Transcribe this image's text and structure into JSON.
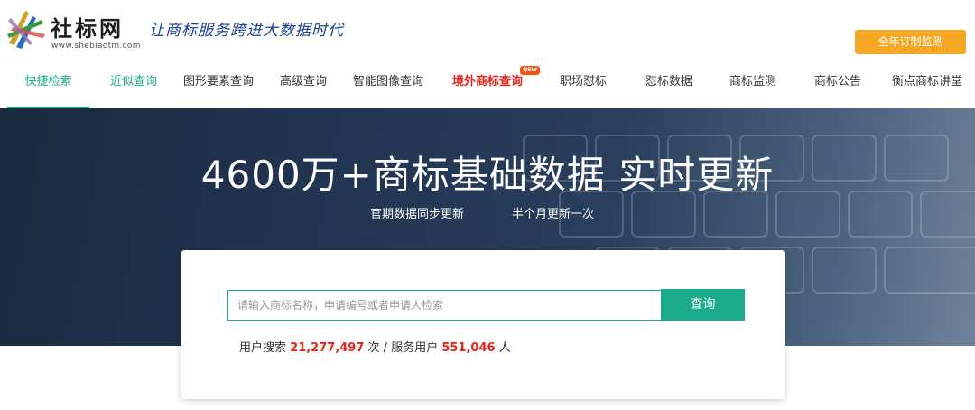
{
  "header": {
    "logo_name": "社标网",
    "logo_url": "www.shebiaotm.com",
    "slogan": "让商标服务跨进大数据时代",
    "order_button": "全年订制监测"
  },
  "nav": {
    "items": [
      {
        "label": "快捷检索"
      },
      {
        "label": "近似查询"
      },
      {
        "label": "图形要素查询"
      },
      {
        "label": "高级查询"
      },
      {
        "label": "智能图像查询"
      },
      {
        "label": "境外商标查询",
        "badge": "NEW"
      },
      {
        "label": "职场怼标"
      },
      {
        "label": "怼标数据"
      },
      {
        "label": "商标监测"
      },
      {
        "label": "商标公告"
      },
      {
        "label": "衡点商标讲堂"
      }
    ]
  },
  "hero": {
    "title": "4600万+商标基础数据 实时更新",
    "sub_left": "官期数据同步更新",
    "sub_right": "半个月更新一次"
  },
  "search": {
    "placeholder": "请输入商标名称，申请编号或者申请人检索",
    "button": "查询"
  },
  "stats": {
    "prefix": "用户搜索",
    "searches": "21,277,497",
    "mid": "次 / 服务用户",
    "users": "551,046",
    "suffix": "人"
  },
  "colors": {
    "accent": "#1aab8a",
    "highlight": "#e8231b",
    "order_button": "#f5a623",
    "hero_bg": "#223552"
  }
}
